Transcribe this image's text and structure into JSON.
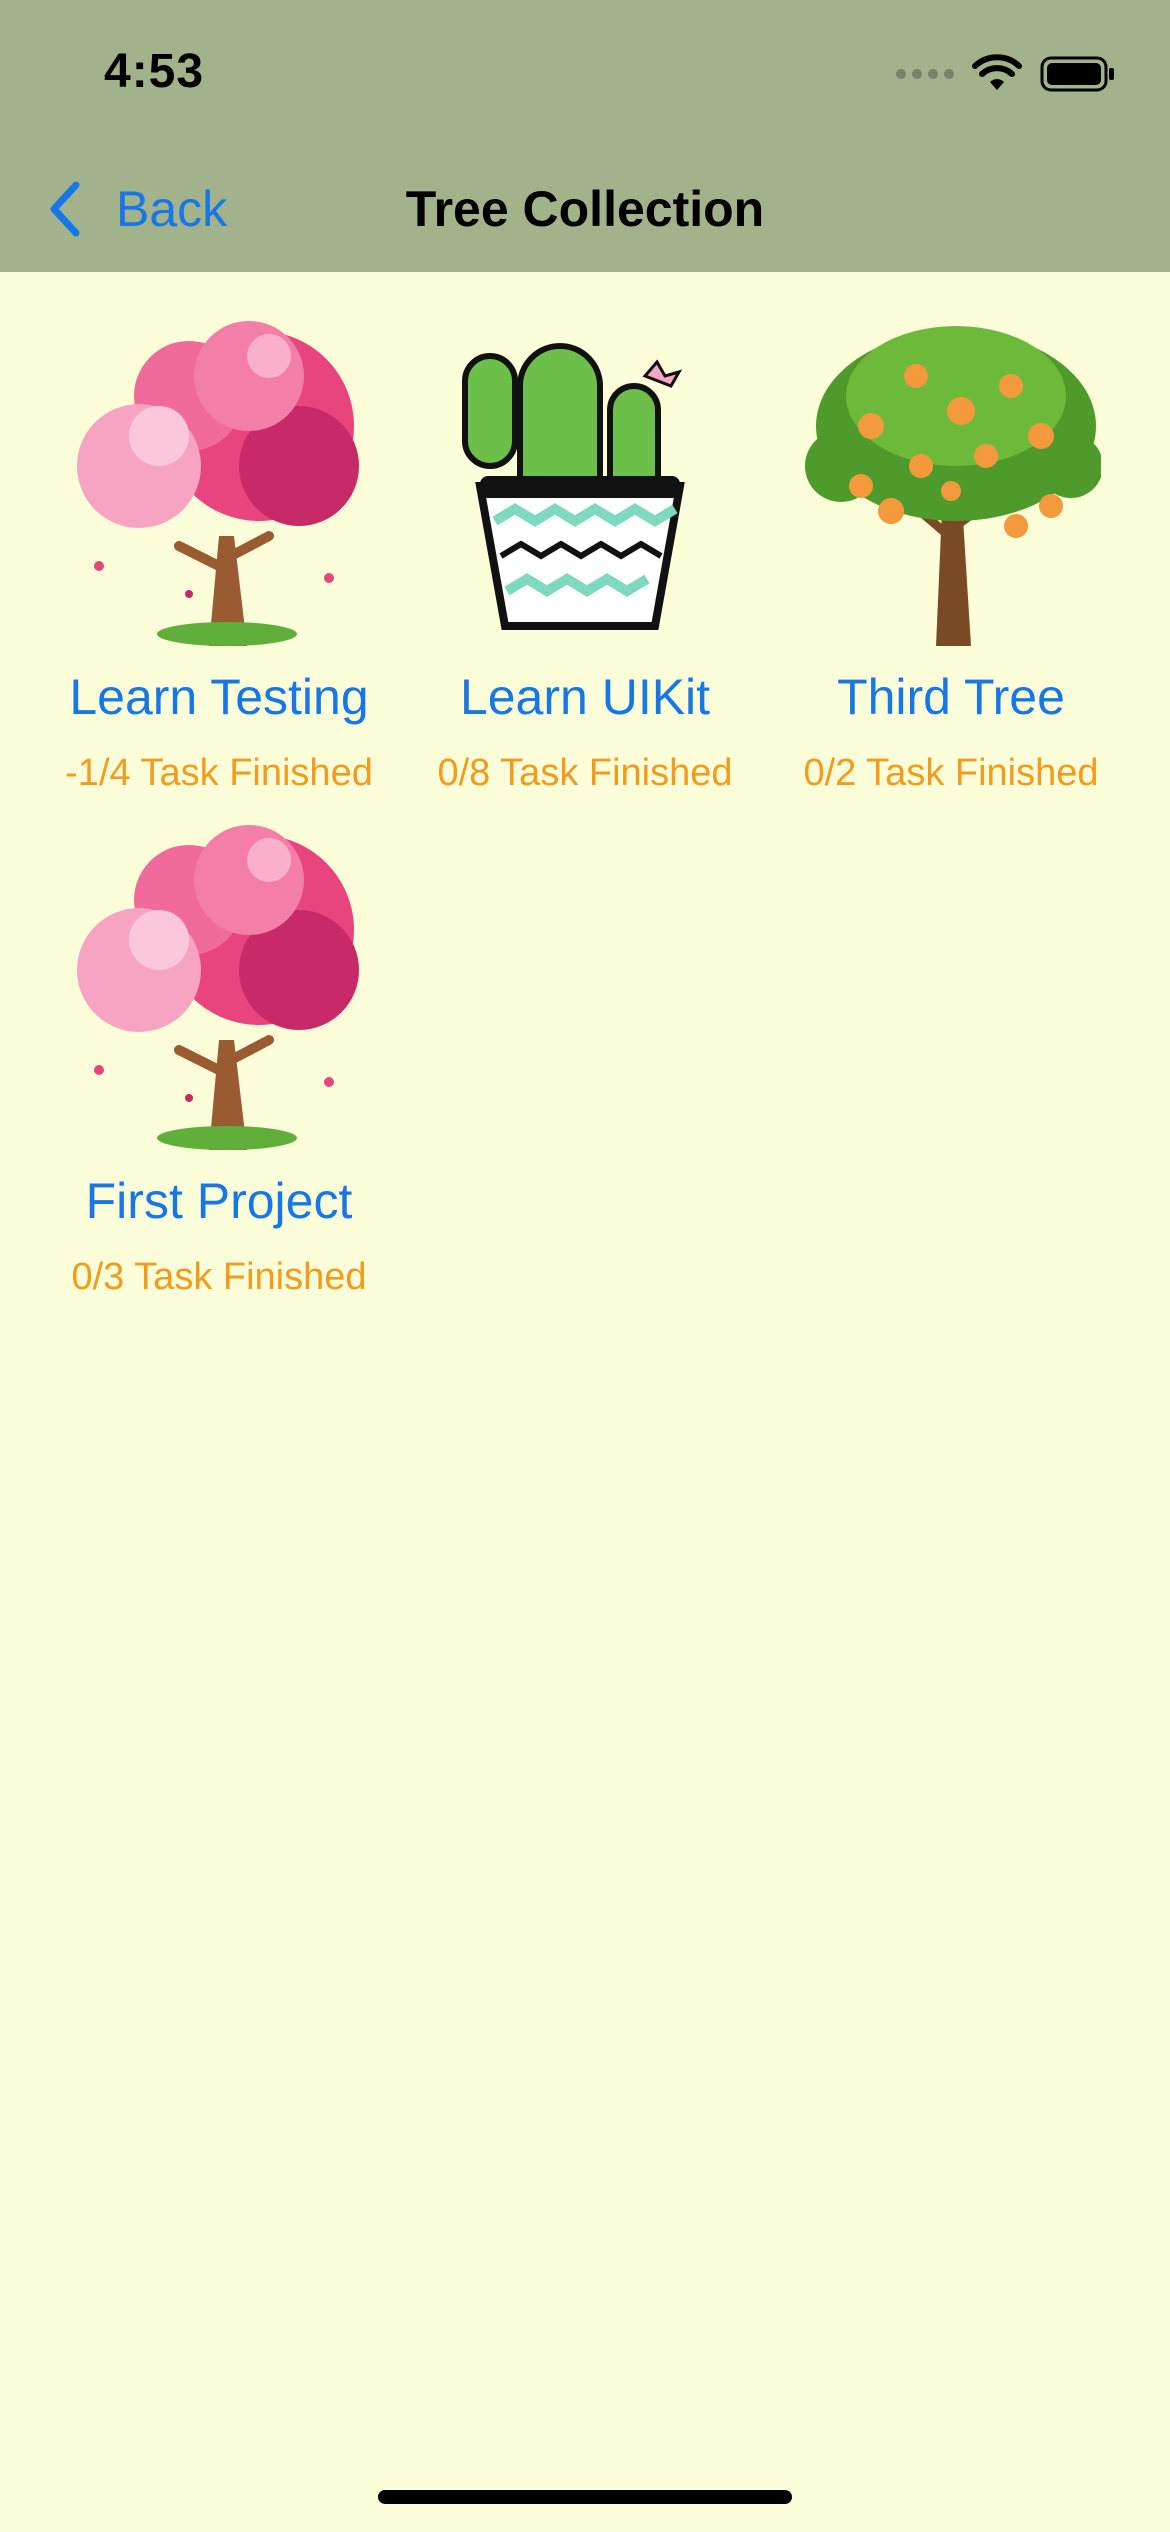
{
  "status_bar": {
    "time": "4:53",
    "icons": [
      "cellular-signal-icon",
      "wifi-icon",
      "battery-icon"
    ]
  },
  "nav": {
    "back_label": "Back",
    "title": "Tree Collection"
  },
  "trees": [
    {
      "name": "Learn Testing",
      "progress": "-1/4 Task Finished",
      "icon": "pink-blossom-tree-icon"
    },
    {
      "name": "Learn UIKit",
      "progress": "0/8 Task Finished",
      "icon": "potted-cactus-icon"
    },
    {
      "name": "Third Tree",
      "progress": "0/2 Task Finished",
      "icon": "orange-fruit-tree-icon"
    },
    {
      "name": "First Project",
      "progress": "0/3 Task Finished",
      "icon": "pink-blossom-tree-icon"
    }
  ],
  "colors": {
    "header_bg": "#A2B28A",
    "page_bg": "#FCFDD9",
    "link_blue": "#1877E8",
    "progress_orange": "#F39B1A"
  }
}
